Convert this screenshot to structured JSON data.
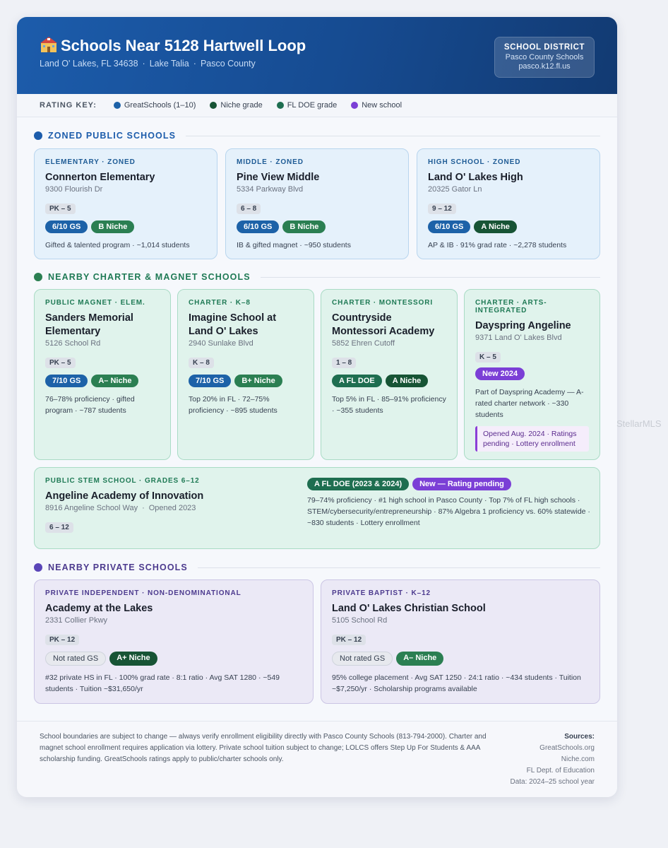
{
  "header": {
    "icon": "school-building-icon",
    "title": "Schools Near 5128 Hartwell Loop",
    "location_parts": [
      "Land O' Lakes, FL 34638",
      "Lake Talia",
      "Pasco County"
    ],
    "separator": "·",
    "district_label": "SCHOOL DISTRICT",
    "district_name": "Pasco County Schools",
    "district_site": "pasco.k12.fl.us",
    "color": "#1c5cab"
  },
  "rating_key": {
    "label": "RATING KEY:",
    "items": [
      {
        "label": "GreatSchools (1–10)",
        "color": "#1d62a8"
      },
      {
        "label": "Niche grade",
        "color": "#175435"
      },
      {
        "label": "FL DOE grade",
        "color": "#1e6e50"
      },
      {
        "label": "New school",
        "color": "#7b3fd6"
      }
    ]
  },
  "sections": {
    "zoned": {
      "title": "ZONED PUBLIC SCHOOLS",
      "color": "#1c5cab"
    },
    "charter": {
      "title": "NEARBY CHARTER & MAGNET SCHOOLS",
      "color": "#2b7f52"
    },
    "private": {
      "title": "NEARBY PRIVATE SCHOOLS",
      "color": "#5a45b8"
    }
  },
  "zoned": [
    {
      "tag": "ELEMENTARY · ZONED",
      "name": "Connerton Elementary",
      "address": "9300 Flourish Dr",
      "grades": "PK – 5",
      "gs": "6/10 GS",
      "niche": "B Niche",
      "desc": "Gifted & talented program · ~1,014 students"
    },
    {
      "tag": "MIDDLE · ZONED",
      "name": "Pine View Middle",
      "address": "5334 Parkway Blvd",
      "grades": "6 – 8",
      "gs": "6/10 GS",
      "niche": "B Niche",
      "desc": "IB & gifted magnet · ~950 students"
    },
    {
      "tag": "HIGH SCHOOL · ZONED",
      "name": "Land O' Lakes High",
      "address": "20325 Gator Ln",
      "grades": "9 – 12",
      "gs": "6/10 GS",
      "niche": "A Niche",
      "desc": "AP & IB · 91% grad rate · ~2,278 students"
    }
  ],
  "charter": [
    {
      "tag": "PUBLIC MAGNET · ELEM.",
      "name": "Sanders Memorial Elementary",
      "address": "5126 School Rd",
      "grades": "PK – 5",
      "rating1": "7/10 GS",
      "rating2": "A– Niche",
      "desc": "76–78% proficiency · gifted program · ~787 students"
    },
    {
      "tag": "CHARTER · K–8",
      "name": "Imagine School at Land O' Lakes",
      "address": "2940 Sunlake Blvd",
      "grades": "K – 8",
      "rating1": "7/10 GS",
      "rating2": "B+ Niche",
      "desc": "Top 20% in FL · 72–75% proficiency · ~895 students"
    },
    {
      "tag": "CHARTER · MONTESSORI",
      "name": "Countryside Montessori Academy",
      "address": "5852 Ehren Cutoff",
      "grades": "1 – 8",
      "rating1": "A FL DOE",
      "rating2": "A Niche",
      "desc": "Top 5% in FL · 85–91% proficiency · ~355 students"
    },
    {
      "tag": "CHARTER · ARTS-INTEGRATED",
      "name": "Dayspring Angeline",
      "address": "9371 Land O' Lakes Blvd",
      "grades": "K – 5",
      "rating1": "New 2024",
      "desc": "Part of Dayspring Academy — A-rated charter network · ~330 students",
      "note": "Opened Aug. 2024 · Ratings pending · Lottery enrollment"
    }
  ],
  "stem": {
    "tag": "PUBLIC STEM SCHOOL · GRADES 6–12",
    "name": "Angeline Academy of Innovation",
    "address": "8916 Angeline School Way",
    "opened": "Opened 2023",
    "grades": "6 – 12",
    "rating1": "A FL DOE (2023 & 2024)",
    "rating2": "New — Rating pending",
    "desc": "79–74% proficiency · #1 high school in Pasco County · Top 7% of FL high schools · STEM/cybersecurity/entrepreneurship · 87% Algebra 1 proficiency vs. 60% statewide · ~830 students · Lottery enrollment"
  },
  "private": [
    {
      "tag": "PRIVATE INDEPENDENT · NON-DENOMINATIONAL",
      "name": "Academy at the Lakes",
      "address": "2331 Collier Pkwy",
      "grades": "PK – 12",
      "gs": "Not rated GS",
      "niche": "A+ Niche",
      "desc": "#32 private HS in FL · 100% grad rate · 8:1 ratio · Avg SAT 1280 · ~549 students · Tuition ~$31,650/yr"
    },
    {
      "tag": "PRIVATE BAPTIST · K–12",
      "name": "Land O' Lakes Christian School",
      "address": "5105 School Rd",
      "grades": "PK – 12",
      "gs": "Not rated GS",
      "niche": "A– Niche",
      "desc": "95% college placement · Avg SAT 1250 · 24:1 ratio · ~434 students · Tuition ~$7,250/yr · Scholarship programs available"
    }
  ],
  "footer": {
    "disclaimer": "School boundaries are subject to change — always verify enrollment eligibility directly with Pasco County Schools (813-794-2000). Charter and magnet school enrollment requires application via lottery. Private school tuition subject to change; LOLCS offers Step Up For Students & AAA scholarship funding. GreatSchools ratings apply to public/charter schools only.",
    "sources_label": "Sources:",
    "sources": [
      "GreatSchools.org",
      "Niche.com",
      "FL Dept. of Education",
      "Data: 2024–25 school year"
    ]
  },
  "watermark": "StellarMLS"
}
